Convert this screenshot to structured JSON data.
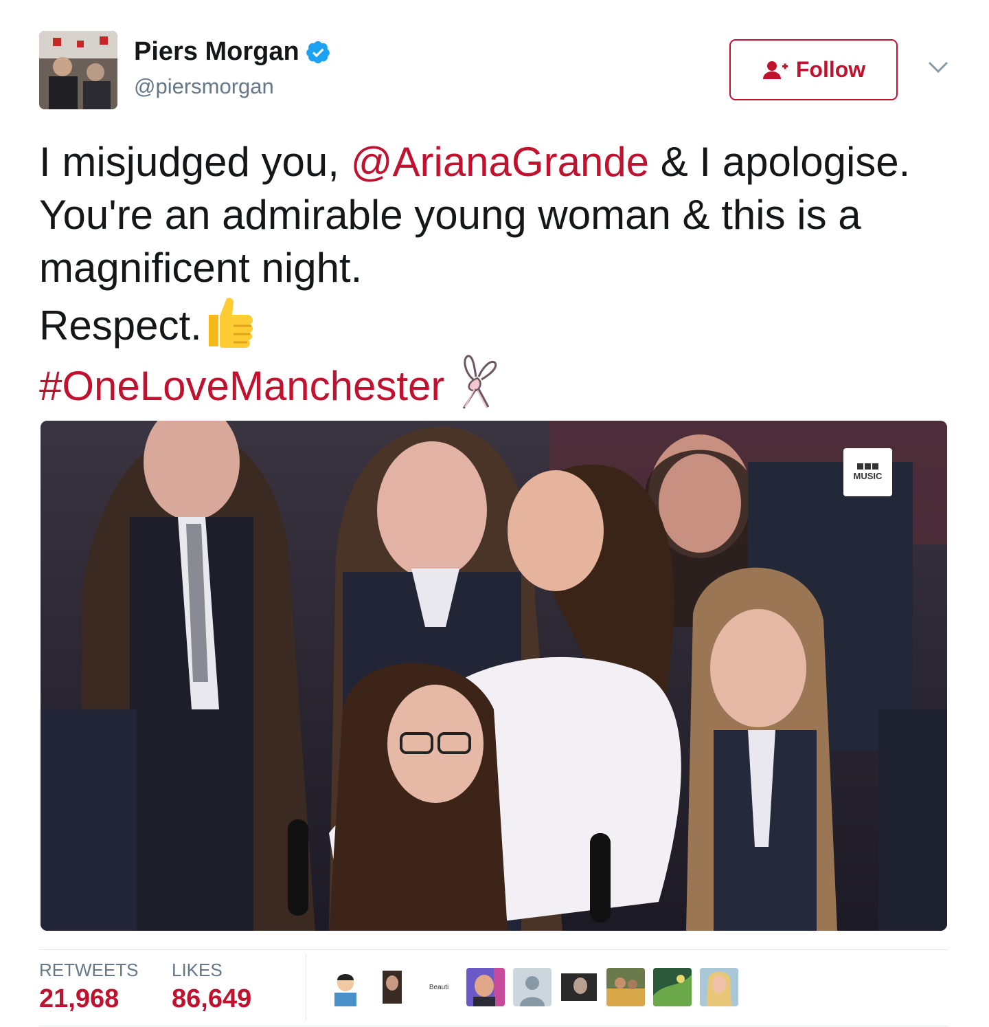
{
  "author": {
    "name": "Piers Morgan",
    "handle": "@piersmorgan",
    "verified": true
  },
  "follow_button": {
    "label": "Follow",
    "icon": "add-user-icon"
  },
  "tweet": {
    "line1_pre": "I misjudged you, ",
    "mention": "@ArianaGrande",
    "line1_post": " & I apologise.",
    "line2": "You're an admirable young woman & this is a",
    "line3": "magnificent night.",
    "line4": "Respect.",
    "hashtag": "#OneLoveManchester",
    "emojis": [
      "thumbs-up-icon",
      "ribbon-bunny-icon"
    ]
  },
  "media": {
    "badge_text": "MUSIC"
  },
  "stats": {
    "retweets_label": "RETWEETS",
    "retweets_value": "21,968",
    "likes_label": "LIKES",
    "likes_value": "86,649"
  },
  "likers": [
    {
      "icon": "cartoon-avatar-icon"
    },
    {
      "icon": "photo-avatar-icon"
    },
    {
      "icon": "text-avatar-icon",
      "text": "Beauti"
    },
    {
      "icon": "photo-avatar-icon"
    },
    {
      "icon": "default-avatar-icon"
    },
    {
      "icon": "photo-avatar-icon"
    },
    {
      "icon": "photo-avatar-icon"
    },
    {
      "icon": "photo-avatar-icon"
    },
    {
      "icon": "photo-avatar-icon"
    }
  ],
  "colors": {
    "accent": "#c0112f",
    "verified_blue": "#1da1f2",
    "muted": "#657786",
    "text": "#14171a"
  }
}
